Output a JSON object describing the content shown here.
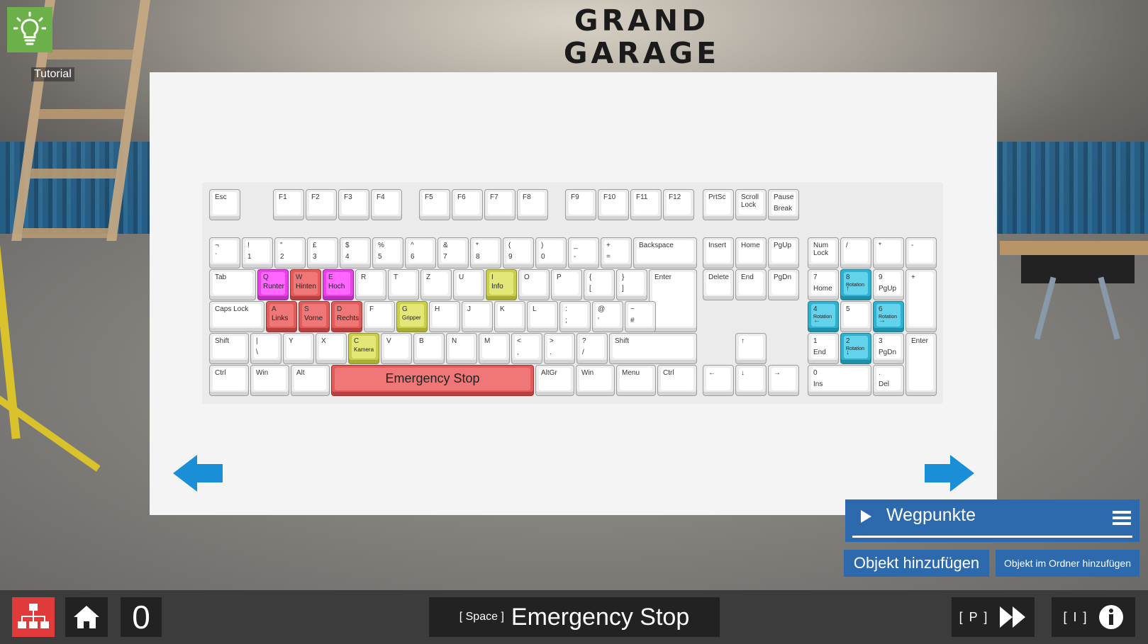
{
  "logo": {
    "line1": "GRAND",
    "line2": "GARAGE"
  },
  "tutorial": {
    "label": "Tutorial",
    "icon": "lightbulb-icon"
  },
  "keyboard": {
    "function_row": {
      "esc": "Esc",
      "f1": "F1",
      "f2": "F2",
      "f3": "F3",
      "f4": "F4",
      "f5": "F5",
      "f6": "F6",
      "f7": "F7",
      "f8": "F8",
      "f9": "F9",
      "f10": "F10",
      "f11": "F11",
      "f12": "F12",
      "prtsc": "PrtSc",
      "scroll": "Scroll\nLock",
      "pause_top": "Pause",
      "pause_bottom": "Break"
    },
    "number_row": [
      {
        "top": "¬",
        "bottom": "`"
      },
      {
        "top": "!",
        "bottom": "1"
      },
      {
        "top": "\"",
        "bottom": "2"
      },
      {
        "top": "£",
        "bottom": "3"
      },
      {
        "top": "$",
        "bottom": "4"
      },
      {
        "top": "%",
        "bottom": "5"
      },
      {
        "top": "^",
        "bottom": "6"
      },
      {
        "top": "&",
        "bottom": "7"
      },
      {
        "top": "*",
        "bottom": "8"
      },
      {
        "top": "(",
        "bottom": "9"
      },
      {
        "top": ")",
        "bottom": "0"
      },
      {
        "top": "_",
        "bottom": "-"
      },
      {
        "top": "+",
        "bottom": "="
      }
    ],
    "backspace": "Backspace",
    "tab": "Tab",
    "q": {
      "letter": "Q",
      "action": "Runter"
    },
    "w": {
      "letter": "W",
      "action": "Hinten"
    },
    "e": {
      "letter": "E",
      "action": "Hoch"
    },
    "r": "R",
    "t": "T",
    "z": "Z",
    "u": "U",
    "i": {
      "letter": "I",
      "action": "Info"
    },
    "o": "O",
    "p": "P",
    "lbracket": {
      "top": "{",
      "bottom": "["
    },
    "rbracket": {
      "top": "}",
      "bottom": "]"
    },
    "enter": "Enter",
    "capslock": "Caps Lock",
    "a": {
      "letter": "A",
      "action": "Links"
    },
    "s": {
      "letter": "S",
      "action": "Vorne"
    },
    "d": {
      "letter": "D",
      "action": "Rechts"
    },
    "f": "F",
    "g": {
      "letter": "G",
      "action": "Gripper"
    },
    "h": "H",
    "j": "J",
    "k": "K",
    "l": "L",
    "semicolon": {
      "top": ":",
      "bottom": ";"
    },
    "quote": {
      "top": "@",
      "bottom": "'"
    },
    "hash": {
      "top": "~",
      "bottom": "#"
    },
    "shift_left": "Shift",
    "backslash": {
      "top": "|",
      "bottom": "\\"
    },
    "y": "Y",
    "x": "X",
    "c": {
      "letter": "C",
      "action": "Kamera"
    },
    "v": "V",
    "b": "B",
    "n": "N",
    "m": "M",
    "comma": {
      "top": "<",
      "bottom": ","
    },
    "period": {
      "top": ">",
      "bottom": "."
    },
    "slash": {
      "top": "?",
      "bottom": "/"
    },
    "shift_right": "Shift",
    "ctrl_left": "Ctrl",
    "win_left": "Win",
    "alt": "Alt",
    "space": "Emergency Stop",
    "altgr": "AltGr",
    "win_right": "Win",
    "menu": "Menu",
    "ctrl_right": "Ctrl",
    "insert": "Insert",
    "home": "Home",
    "pgup": "PgUp",
    "delete": "Delete",
    "end": "End",
    "pgdn": "PgDn",
    "arrow_up": "↑",
    "arrow_left": "←",
    "arrow_down": "↓",
    "arrow_right": "→",
    "numpad": {
      "numlock": "Num\nLock",
      "divide": "/",
      "multiply": "*",
      "minus": "-",
      "plus": "+",
      "n7": {
        "top": "7",
        "bottom": "Home"
      },
      "n8": {
        "top": "8",
        "mid": "Rotation",
        "bottom": "↑"
      },
      "n9": {
        "top": "9",
        "bottom": "PgUp"
      },
      "n4": {
        "top": "4",
        "mid": "Rotation",
        "bottom": "←"
      },
      "n5": "5",
      "n6": {
        "top": "6",
        "mid": "Rotation",
        "bottom": "→"
      },
      "n1": {
        "top": "1",
        "bottom": "End"
      },
      "n2": {
        "top": "2",
        "mid": "Rotation",
        "bottom": "↓"
      },
      "n3": {
        "top": "3",
        "bottom": "PgDn"
      },
      "enter": "Enter",
      "n0": {
        "top": "0",
        "bottom": "Ins"
      },
      "dot": {
        "top": ".",
        "bottom": "Del"
      }
    }
  },
  "navigation": {
    "prev_icon": "arrow-left-icon",
    "next_icon": "arrow-right-icon"
  },
  "waypoints": {
    "title": "Wegpunkte"
  },
  "buttons": {
    "add_object": "Objekt hinzufügen",
    "add_object_folder": "Objekt im Ordner hinzufügen"
  },
  "bottombar": {
    "counter": "0",
    "emergency_key": "[ Space ]",
    "emergency_label": "Emergency Stop",
    "play_key": "[ P ]",
    "info_key": "[ I ]"
  },
  "colors": {
    "accent_blue": "#2c6aad",
    "red": "#e35a5a",
    "pink": "#ff66ff",
    "yellow": "#e2e778",
    "cyan": "#63d3eb",
    "arrow_blue": "#1a8fd8"
  }
}
